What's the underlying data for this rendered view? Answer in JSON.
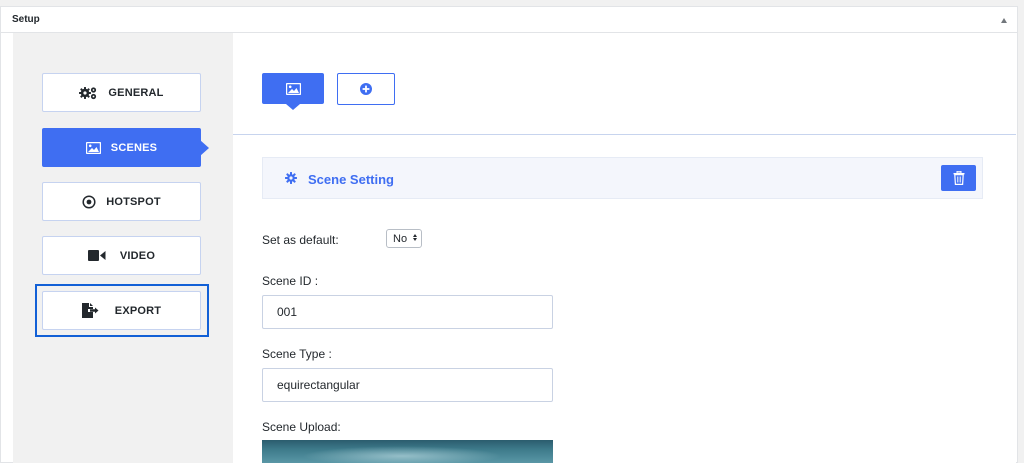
{
  "panel": {
    "title": "Setup"
  },
  "sidebar": {
    "items": [
      {
        "label": "GENERAL",
        "icon": "gears-icon",
        "active": false
      },
      {
        "label": "SCENES",
        "icon": "image-icon",
        "active": true
      },
      {
        "label": "HOTSPOT",
        "icon": "target-icon",
        "active": false
      },
      {
        "label": "VIDEO",
        "icon": "video-camera-icon",
        "active": false
      },
      {
        "label": "EXPORT",
        "icon": "file-export-icon",
        "active": false,
        "highlighted": true
      }
    ]
  },
  "scene_tabs": [
    {
      "icon": "image-icon",
      "active": true
    },
    {
      "icon": "plus-circle-icon",
      "active": false
    }
  ],
  "scene_setting": {
    "title": "Scene Setting",
    "default_label": "Set as default:",
    "default_value": "No",
    "id_label": "Scene ID :",
    "id_value": "001",
    "type_label": "Scene Type :",
    "type_value": "equirectangular",
    "upload_label": "Scene Upload:"
  },
  "colors": {
    "accent": "#3f6ef2",
    "highlight_outline": "#1260d6",
    "sidebar_bg": "#f1f1f1"
  }
}
